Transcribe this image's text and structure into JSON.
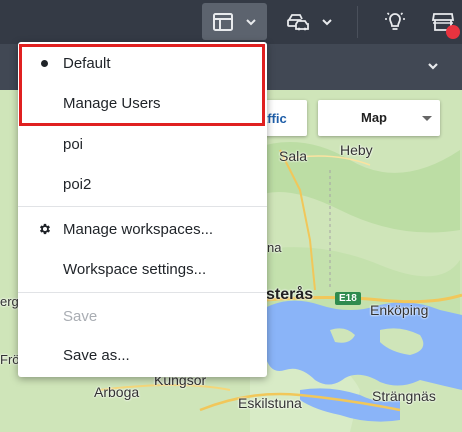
{
  "menu": {
    "items": [
      {
        "label": "Default",
        "selected": true
      },
      {
        "label": "Manage Users"
      },
      {
        "label": "poi"
      },
      {
        "label": "poi2"
      },
      {
        "label": "Manage workspaces...",
        "icon": "gear-icon"
      },
      {
        "label": "Workspace settings..."
      },
      {
        "label": "Save",
        "disabled": true
      },
      {
        "label": "Save as..."
      }
    ]
  },
  "map": {
    "traffic_label": "affic",
    "map_type_label": "Map",
    "places": [
      "Sala",
      "Heby",
      "Enköping",
      "sterås",
      "Kungsör",
      "Arboga",
      "Eskilstuna",
      "Strängnäs",
      "na",
      "erg",
      "Frö"
    ],
    "road_e18": "E18"
  },
  "colors": {
    "highlight": "#e02020",
    "toolbar": "#343a45",
    "notification": "#e8333f"
  }
}
